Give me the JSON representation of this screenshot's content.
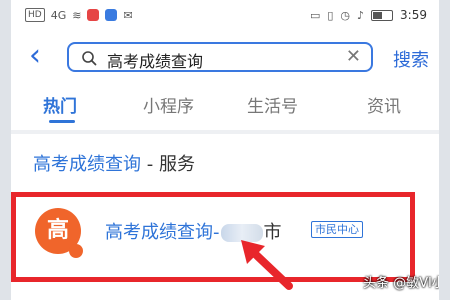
{
  "status_bar": {
    "carrier_badge": "HD",
    "signal": "4G",
    "time": "3:59"
  },
  "search": {
    "query": "高考成绩查询",
    "button_label": "搜索"
  },
  "tabs": [
    {
      "label": "热门",
      "active": true
    },
    {
      "label": "小程序",
      "active": false
    },
    {
      "label": "生活号",
      "active": false
    },
    {
      "label": "资讯",
      "active": false
    }
  ],
  "section": {
    "keyword": "高考成绩查询",
    "suffix": " - 服务"
  },
  "result": {
    "logo_char": "高",
    "title": "高考成绩查询-",
    "city_suffix": "市",
    "tag": "市民中心"
  },
  "watermark": "头条 @敏VI小姐",
  "colors": {
    "accent": "#2f74d8",
    "highlight": "#e8262b",
    "logo": "#f0652b"
  }
}
